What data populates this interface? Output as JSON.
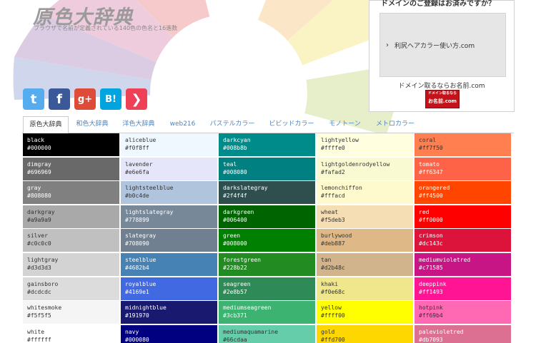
{
  "header": {
    "title": "原色大辞典",
    "subtitle": "ブラウザで名前が定義されている140色の色名と16進数"
  },
  "social": {
    "icons": [
      {
        "name": "twitter-icon",
        "glyph": "t",
        "color": "#55acee"
      },
      {
        "name": "facebook-icon",
        "glyph": "f",
        "color": "#3b5998"
      },
      {
        "name": "google-plus-icon",
        "glyph": "g+",
        "color": "#dd4b39"
      },
      {
        "name": "hatena-bookmark-icon",
        "glyph": "B!",
        "color": "#00a4de"
      },
      {
        "name": "pocket-icon",
        "glyph": "❯",
        "color": "#ee4056"
      }
    ]
  },
  "ad": {
    "heading": "ドメインのご登録はお済みですか？",
    "link": "利尻ヘアカラー使い方.com",
    "caption": "ドメイン取るならお名前.com",
    "banner_line1": "ドメイン取るなら",
    "banner_line2": "お名前.com"
  },
  "tabs": [
    {
      "label": "原色大辞典",
      "active": true
    },
    {
      "label": "和色大辞典",
      "active": false
    },
    {
      "label": "洋色大辞典",
      "active": false
    },
    {
      "label": "web216",
      "active": false
    },
    {
      "label": "パステルカラー",
      "active": false
    },
    {
      "label": "ビビッドカラー",
      "active": false
    },
    {
      "label": "モノトーン",
      "active": false
    },
    {
      "label": "メトロカラー",
      "active": false
    }
  ],
  "colors": [
    [
      {
        "name": "black",
        "hex": "#000000"
      },
      {
        "name": "dimgray",
        "hex": "#696969"
      },
      {
        "name": "gray",
        "hex": "#808080"
      },
      {
        "name": "darkgray",
        "hex": "#a9a9a9"
      },
      {
        "name": "silver",
        "hex": "#c0c0c0"
      },
      {
        "name": "lightgray",
        "hex": "#d3d3d3"
      },
      {
        "name": "gainsboro",
        "hex": "#dcdcdc"
      },
      {
        "name": "whitesmoke",
        "hex": "#f5f5f5"
      },
      {
        "name": "white",
        "hex": "#ffffff"
      }
    ],
    [
      {
        "name": "aliceblue",
        "hex": "#f0f8ff"
      },
      {
        "name": "lavender",
        "hex": "#e6e6fa"
      },
      {
        "name": "lightsteelblue",
        "hex": "#b0c4de"
      },
      {
        "name": "lightslategray",
        "hex": "#778899"
      },
      {
        "name": "slategray",
        "hex": "#708090"
      },
      {
        "name": "steelblue",
        "hex": "#4682b4"
      },
      {
        "name": "royalblue",
        "hex": "#4169e1"
      },
      {
        "name": "midnightblue",
        "hex": "#191970"
      },
      {
        "name": "navy",
        "hex": "#000080"
      }
    ],
    [
      {
        "name": "darkcyan",
        "hex": "#008b8b"
      },
      {
        "name": "teal",
        "hex": "#008080"
      },
      {
        "name": "darkslategray",
        "hex": "#2f4f4f"
      },
      {
        "name": "darkgreen",
        "hex": "#006400"
      },
      {
        "name": "green",
        "hex": "#008000"
      },
      {
        "name": "forestgreen",
        "hex": "#228b22"
      },
      {
        "name": "seagreen",
        "hex": "#2e8b57"
      },
      {
        "name": "mediumseagreen",
        "hex": "#3cb371"
      },
      {
        "name": "mediumaquamarine",
        "hex": "#66cdaa"
      }
    ],
    [
      {
        "name": "lightyellow",
        "hex": "#ffffe0"
      },
      {
        "name": "lightgoldenrodyellow",
        "hex": "#fafad2"
      },
      {
        "name": "lemonchiffon",
        "hex": "#fffacd"
      },
      {
        "name": "wheat",
        "hex": "#f5deb3"
      },
      {
        "name": "burlywood",
        "hex": "#deb887"
      },
      {
        "name": "tan",
        "hex": "#d2b48c"
      },
      {
        "name": "khaki",
        "hex": "#f0e68c"
      },
      {
        "name": "yellow",
        "hex": "#ffff00"
      },
      {
        "name": "gold",
        "hex": "#ffd700"
      }
    ],
    [
      {
        "name": "coral",
        "hex": "#ff7f50"
      },
      {
        "name": "tomato",
        "hex": "#ff6347"
      },
      {
        "name": "orangered",
        "hex": "#ff4500"
      },
      {
        "name": "red",
        "hex": "#ff0000"
      },
      {
        "name": "crimson",
        "hex": "#dc143c"
      },
      {
        "name": "mediumvioletred",
        "hex": "#c71585"
      },
      {
        "name": "deeppink",
        "hex": "#ff1493"
      },
      {
        "name": "hotpink",
        "hex": "#ff69b4"
      },
      {
        "name": "palevioletred",
        "hex": "#db7093"
      }
    ]
  ],
  "text_colors": {
    "light_text": "#ffffff",
    "dark_text": "#333333"
  }
}
